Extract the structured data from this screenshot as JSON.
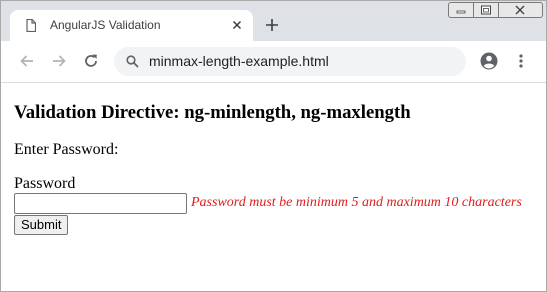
{
  "browser": {
    "tab": {
      "title": "AngularJS Validation",
      "icon": "file-icon"
    },
    "new_tab_icon": "plus-icon",
    "window_controls": [
      "minimize-icon",
      "restore-icon",
      "close-icon"
    ],
    "toolbar": {
      "back_icon": "arrow-left-icon",
      "forward_icon": "arrow-right-icon",
      "reload_icon": "reload-icon",
      "profile_icon": "account-icon",
      "menu_icon": "kebab-menu-icon"
    },
    "omnibox": {
      "search_icon": "search-icon",
      "url": "minmax-length-example.html"
    }
  },
  "page": {
    "heading": "Validation Directive: ng-minlength, ng-maxlength",
    "enter_label": "Enter Password:",
    "password_label": "Password",
    "password_value": "",
    "error_message": "Password must be minimum 5 and maximum 10 characters",
    "submit_label": "Submit"
  },
  "colors": {
    "tabstrip": "#dee1e6",
    "omnibox": "#f1f3f4",
    "error": "#e01b1b"
  }
}
